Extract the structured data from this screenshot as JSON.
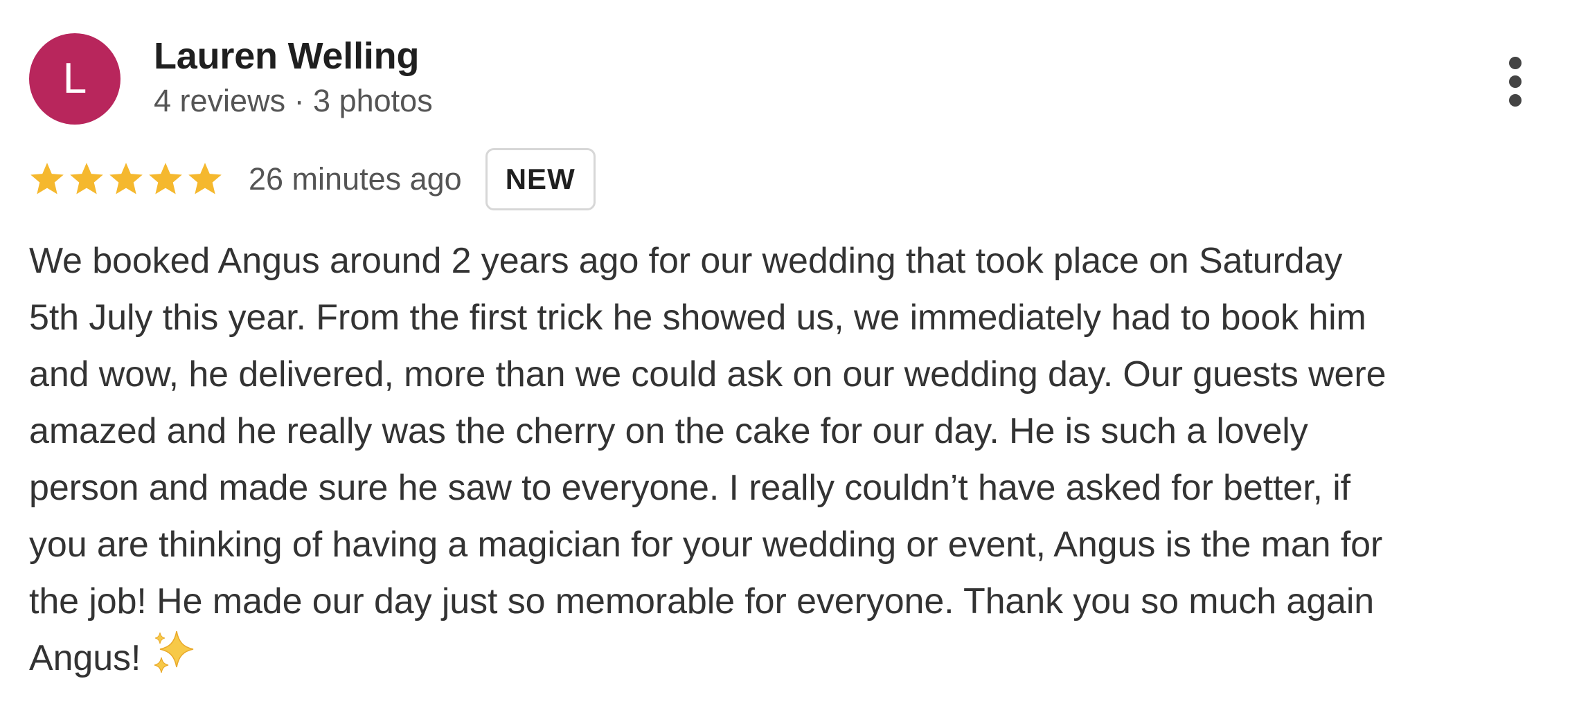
{
  "review": {
    "author": {
      "initial": "L",
      "name": "Lauren Welling",
      "meta": "4 reviews · 3 photos",
      "avatar_color": "#b8265c"
    },
    "rating": 5,
    "rating_max": 5,
    "star_color": "#f5b82e",
    "time": "26 minutes ago",
    "badge": "NEW",
    "text_lines": [
      "We booked Angus around 2 years ago for our wedding that took place on Saturday",
      "5th July this year. From the first trick he showed us, we immediately had to book him",
      "and wow, he delivered, more than we could ask on our wedding day. Our guests were",
      "amazed and he really was the cherry on the cake for our day. He is such a lovely",
      "person and made sure he saw to everyone. I really couldn’t have asked for better, if",
      "you are thinking of having a magician for your wedding or event, Angus is the man for",
      "the job! He made our day just so memorable for everyone. Thank you so much again",
      "Angus!"
    ],
    "emoji": "sparkles-icon",
    "menu_icon": "more-vert-icon"
  }
}
